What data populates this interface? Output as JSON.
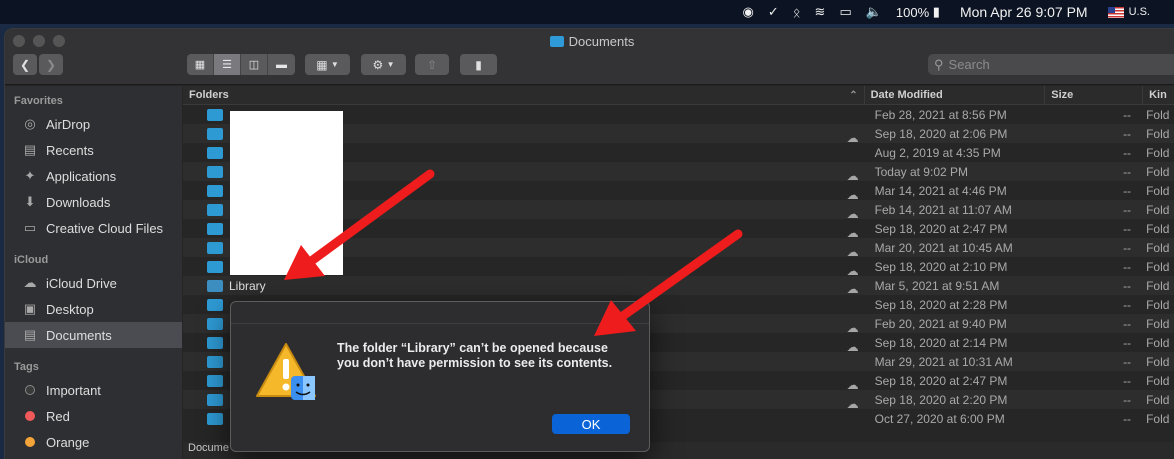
{
  "menubar": {
    "battery": "100%",
    "clock": "Mon Apr 26  9:07 PM",
    "input_source": "U.S."
  },
  "window": {
    "title": "Documents",
    "search_placeholder": "Search"
  },
  "sidebar": {
    "favorites_heading": "Favorites",
    "favorites": [
      {
        "label": "AirDrop",
        "icon": "airdrop-icon"
      },
      {
        "label": "Recents",
        "icon": "clock-icon"
      },
      {
        "label": "Applications",
        "icon": "applications-icon"
      },
      {
        "label": "Downloads",
        "icon": "download-icon"
      },
      {
        "label": "Creative Cloud Files",
        "icon": "folder-icon"
      }
    ],
    "icloud_heading": "iCloud",
    "icloud": [
      {
        "label": "iCloud Drive",
        "icon": "cloud-icon"
      },
      {
        "label": "Desktop",
        "icon": "desktop-icon"
      },
      {
        "label": "Documents",
        "icon": "document-icon"
      }
    ],
    "tags_heading": "Tags",
    "tags": [
      {
        "label": "Important",
        "color": "#3a3a3a"
      },
      {
        "label": "Red",
        "color": "#f0595a"
      },
      {
        "label": "Orange",
        "color": "#f5a43a"
      }
    ]
  },
  "list": {
    "columns": {
      "name": "Folders",
      "date": "Date Modified",
      "size": "Size",
      "kind": "Kin"
    },
    "rows": [
      {
        "name": "",
        "date": "Feb 28, 2021 at 8:56 PM",
        "size": "--",
        "kind": "Fold",
        "cloud": false
      },
      {
        "name": "",
        "date": "Sep 18, 2020 at 2:06 PM",
        "size": "--",
        "kind": "Fold",
        "cloud": true
      },
      {
        "name": "",
        "date": "Aug 2, 2019 at 4:35 PM",
        "size": "--",
        "kind": "Fold",
        "cloud": false
      },
      {
        "name": "",
        "date": "Today at 9:02 PM",
        "size": "--",
        "kind": "Fold",
        "cloud": true
      },
      {
        "name": "",
        "date": "Mar 14, 2021 at 4:46 PM",
        "size": "--",
        "kind": "Fold",
        "cloud": true
      },
      {
        "name": "",
        "date": "Feb 14, 2021 at 11:07 AM",
        "size": "--",
        "kind": "Fold",
        "cloud": true
      },
      {
        "name": "",
        "date": "Sep 18, 2020 at 2:47 PM",
        "size": "--",
        "kind": "Fold",
        "cloud": true
      },
      {
        "name": "",
        "date": "Mar 20, 2021 at 10:45 AM",
        "size": "--",
        "kind": "Fold",
        "cloud": true
      },
      {
        "name": "",
        "date": "Sep 18, 2020 at 2:10 PM",
        "size": "--",
        "kind": "Fold",
        "cloud": true
      },
      {
        "name": "Library",
        "date": "Mar 5, 2021 at 9:51 AM",
        "size": "--",
        "kind": "Fold",
        "cloud": true
      },
      {
        "name": "",
        "date": "Sep 18, 2020 at 2:28 PM",
        "size": "--",
        "kind": "Fold",
        "cloud": false
      },
      {
        "name": "",
        "date": "Feb 20, 2021 at 9:40 PM",
        "size": "--",
        "kind": "Fold",
        "cloud": true
      },
      {
        "name": "",
        "date": "Sep 18, 2020 at 2:14 PM",
        "size": "--",
        "kind": "Fold",
        "cloud": true
      },
      {
        "name": "",
        "date": "Mar 29, 2021 at 10:31 AM",
        "size": "--",
        "kind": "Fold",
        "cloud": false
      },
      {
        "name": "",
        "date": "Sep 18, 2020 at 2:47 PM",
        "size": "--",
        "kind": "Fold",
        "cloud": true
      },
      {
        "name": "",
        "date": "Sep 18, 2020 at 2:20 PM",
        "size": "--",
        "kind": "Fold",
        "cloud": true
      },
      {
        "name": "",
        "date": "Oct 27, 2020 at 6:00 PM",
        "size": "--",
        "kind": "Fold",
        "cloud": false
      }
    ],
    "status_text": "Docume"
  },
  "dialog": {
    "message": "The folder “Library” can’t be opened because you don’t have permission to see its contents.",
    "ok_label": "OK"
  },
  "colors": {
    "accent": "#0a64d8",
    "folder": "#2e9ad4",
    "annotation_arrow": "#ee1c1c"
  }
}
